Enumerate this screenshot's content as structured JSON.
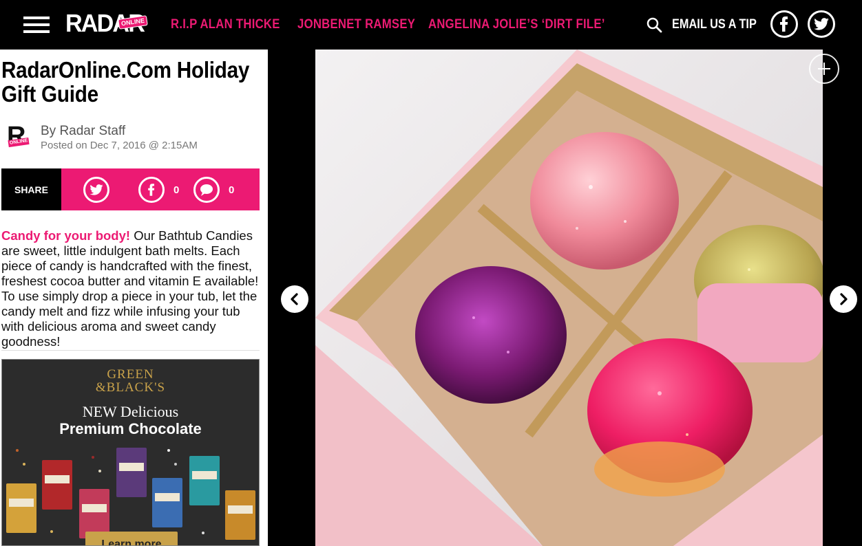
{
  "header": {
    "logo_text": "RADAR",
    "logo_badge": "ONLINE",
    "nav": [
      {
        "label": "R.I.P ALAN THICKE"
      },
      {
        "label": "JONBENET RAMSEY"
      },
      {
        "label": "ANGELINA JOLIE’S ‘DIRT FILE’"
      }
    ],
    "tip_label": "EMAIL US A TIP",
    "icons": {
      "menu": "hamburger-menu-icon",
      "search": "search-icon",
      "facebook": "facebook-icon",
      "twitter": "twitter-icon"
    }
  },
  "article": {
    "title_line1": "RadarOnline.Com Holiday",
    "title_line2": "Gift Guide",
    "author_logo_letter": "R",
    "author_logo_badge": "ONLINE",
    "byline": "By Radar Staff",
    "posted": "Posted on Dec 7, 2016 @ 2:15AM",
    "share": {
      "label": "SHARE",
      "facebook_count": "0",
      "comment_count": "0"
    },
    "body_lead": "Candy for your body!",
    "body_rest": " Our Bathtub Candies are sweet, little indulgent bath melts. Each piece of candy is handcrafted with the finest, freshest cocoa butter and vitamin E available! To use simply drop a piece in your tub, let the candy melt and fizz while infusing your tub with delicious aroma and sweet candy goodness!"
  },
  "ad": {
    "brand_line1": "GREEN",
    "brand_line2": "&BLACK'S",
    "headline1": "NEW Delicious",
    "headline2": "Premium Chocolate",
    "button": "Learn more"
  },
  "gallery": {
    "image_subject": "pink box of four glitter bath candies",
    "icons": {
      "expand": "plus-icon",
      "prev": "chevron-left-icon",
      "next": "chevron-right-icon"
    }
  },
  "colors": {
    "accent": "#ec1a73",
    "topbar": "#000000",
    "ad_gold": "#c9a24a"
  }
}
